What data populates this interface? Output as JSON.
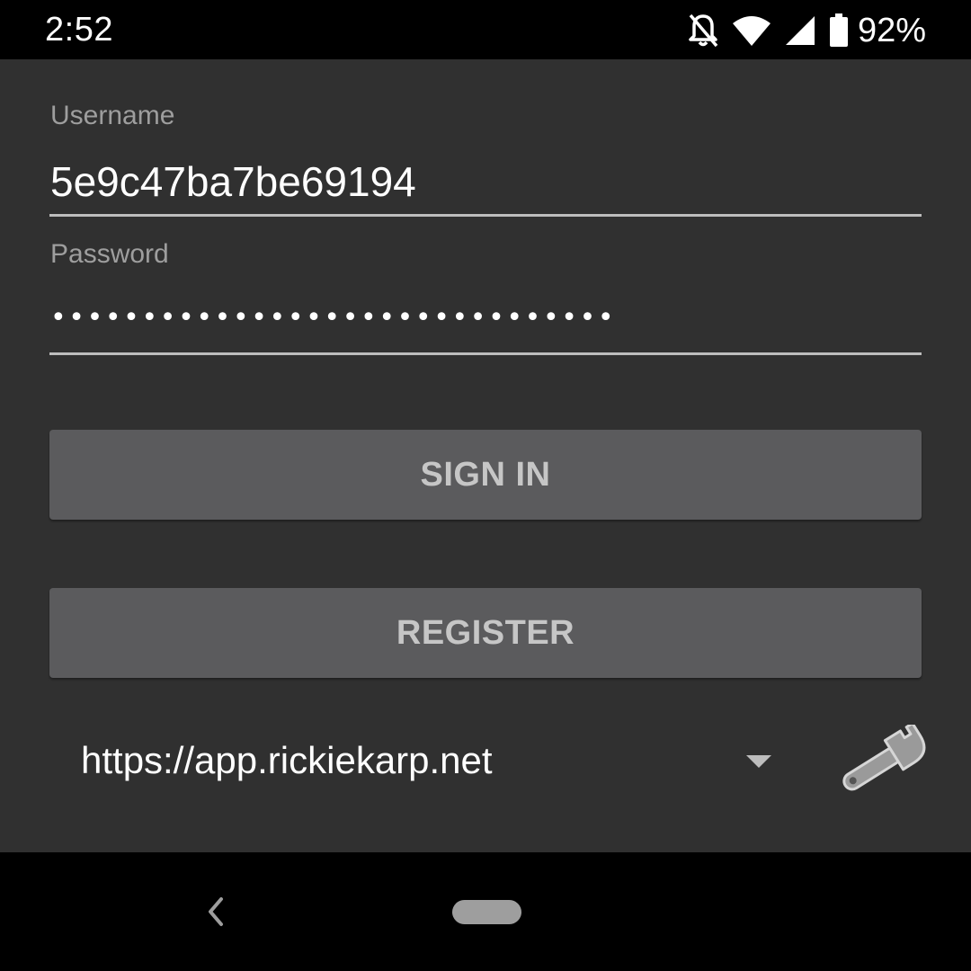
{
  "status_bar": {
    "time": "2:52",
    "battery_percent": "92%",
    "icons": [
      "notifications-off-icon",
      "wifi-icon",
      "cell-signal-icon",
      "battery-icon"
    ]
  },
  "login_form": {
    "username_label": "Username",
    "username_value": "5e9c47ba7be69194",
    "password_label": "Password",
    "password_masked": "•••••••••••••••••••••••••••••••",
    "sign_in_label": "SIGN IN",
    "register_label": "REGISTER"
  },
  "server": {
    "selected_url": "https://app.rickiekarp.net",
    "dropdown_icon": "dropdown-arrow-icon",
    "settings_icon": "wrench-icon"
  },
  "nav_bar": {
    "icons": [
      "back-icon",
      "home-pill"
    ]
  },
  "colors": {
    "background": "#303030",
    "button": "#5b5b5d",
    "button_text": "#c6c6c6",
    "label": "#9e9e9e"
  }
}
